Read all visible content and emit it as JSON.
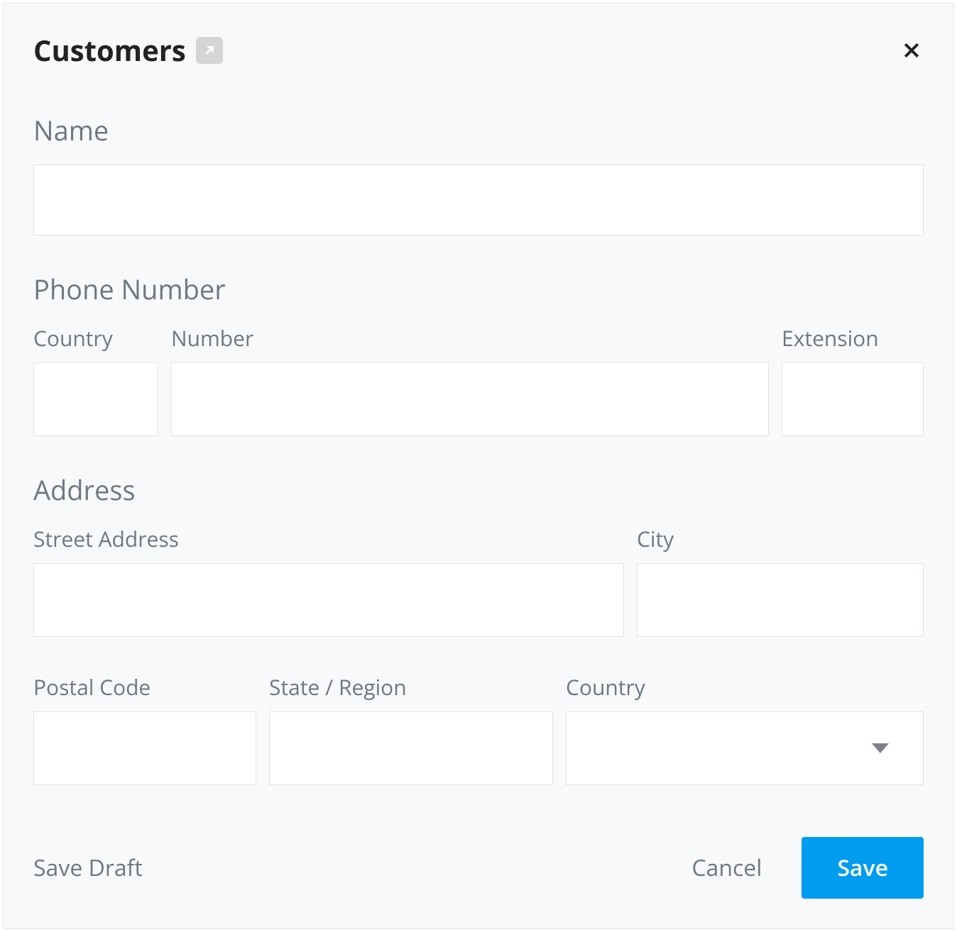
{
  "header": {
    "title": "Customers"
  },
  "sections": {
    "name": {
      "label": "Name",
      "value": ""
    },
    "phone": {
      "label": "Phone Number",
      "fields": {
        "country": {
          "label": "Country",
          "value": ""
        },
        "number": {
          "label": "Number",
          "value": ""
        },
        "extension": {
          "label": "Extension",
          "value": ""
        }
      }
    },
    "address": {
      "label": "Address",
      "fields": {
        "street": {
          "label": "Street Address",
          "value": ""
        },
        "city": {
          "label": "City",
          "value": ""
        },
        "postal": {
          "label": "Postal Code",
          "value": ""
        },
        "state": {
          "label": "State / Region",
          "value": ""
        },
        "country": {
          "label": "Country",
          "value": ""
        }
      }
    }
  },
  "footer": {
    "save_draft": "Save Draft",
    "cancel": "Cancel",
    "save": "Save"
  }
}
